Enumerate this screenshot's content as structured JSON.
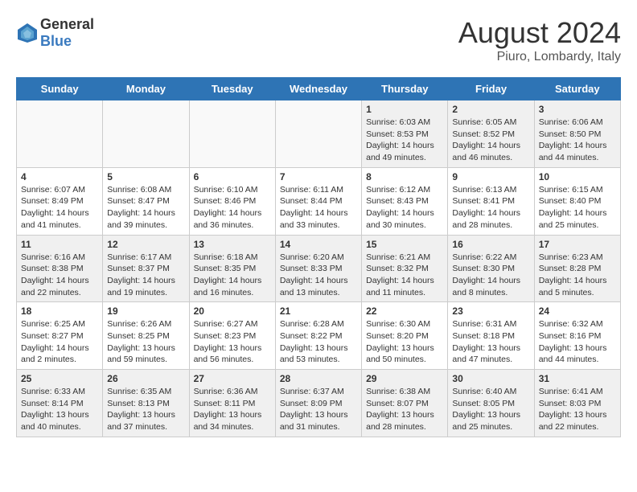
{
  "header": {
    "logo_general": "General",
    "logo_blue": "Blue",
    "month_year": "August 2024",
    "location": "Piuro, Lombardy, Italy"
  },
  "days_of_week": [
    "Sunday",
    "Monday",
    "Tuesday",
    "Wednesday",
    "Thursday",
    "Friday",
    "Saturday"
  ],
  "weeks": [
    [
      {
        "day": "",
        "content": ""
      },
      {
        "day": "",
        "content": ""
      },
      {
        "day": "",
        "content": ""
      },
      {
        "day": "",
        "content": ""
      },
      {
        "day": "1",
        "content": "Sunrise: 6:03 AM\nSunset: 8:53 PM\nDaylight: 14 hours\nand 49 minutes."
      },
      {
        "day": "2",
        "content": "Sunrise: 6:05 AM\nSunset: 8:52 PM\nDaylight: 14 hours\nand 46 minutes."
      },
      {
        "day": "3",
        "content": "Sunrise: 6:06 AM\nSunset: 8:50 PM\nDaylight: 14 hours\nand 44 minutes."
      }
    ],
    [
      {
        "day": "4",
        "content": "Sunrise: 6:07 AM\nSunset: 8:49 PM\nDaylight: 14 hours\nand 41 minutes."
      },
      {
        "day": "5",
        "content": "Sunrise: 6:08 AM\nSunset: 8:47 PM\nDaylight: 14 hours\nand 39 minutes."
      },
      {
        "day": "6",
        "content": "Sunrise: 6:10 AM\nSunset: 8:46 PM\nDaylight: 14 hours\nand 36 minutes."
      },
      {
        "day": "7",
        "content": "Sunrise: 6:11 AM\nSunset: 8:44 PM\nDaylight: 14 hours\nand 33 minutes."
      },
      {
        "day": "8",
        "content": "Sunrise: 6:12 AM\nSunset: 8:43 PM\nDaylight: 14 hours\nand 30 minutes."
      },
      {
        "day": "9",
        "content": "Sunrise: 6:13 AM\nSunset: 8:41 PM\nDaylight: 14 hours\nand 28 minutes."
      },
      {
        "day": "10",
        "content": "Sunrise: 6:15 AM\nSunset: 8:40 PM\nDaylight: 14 hours\nand 25 minutes."
      }
    ],
    [
      {
        "day": "11",
        "content": "Sunrise: 6:16 AM\nSunset: 8:38 PM\nDaylight: 14 hours\nand 22 minutes."
      },
      {
        "day": "12",
        "content": "Sunrise: 6:17 AM\nSunset: 8:37 PM\nDaylight: 14 hours\nand 19 minutes."
      },
      {
        "day": "13",
        "content": "Sunrise: 6:18 AM\nSunset: 8:35 PM\nDaylight: 14 hours\nand 16 minutes."
      },
      {
        "day": "14",
        "content": "Sunrise: 6:20 AM\nSunset: 8:33 PM\nDaylight: 14 hours\nand 13 minutes."
      },
      {
        "day": "15",
        "content": "Sunrise: 6:21 AM\nSunset: 8:32 PM\nDaylight: 14 hours\nand 11 minutes."
      },
      {
        "day": "16",
        "content": "Sunrise: 6:22 AM\nSunset: 8:30 PM\nDaylight: 14 hours\nand 8 minutes."
      },
      {
        "day": "17",
        "content": "Sunrise: 6:23 AM\nSunset: 8:28 PM\nDaylight: 14 hours\nand 5 minutes."
      }
    ],
    [
      {
        "day": "18",
        "content": "Sunrise: 6:25 AM\nSunset: 8:27 PM\nDaylight: 14 hours\nand 2 minutes."
      },
      {
        "day": "19",
        "content": "Sunrise: 6:26 AM\nSunset: 8:25 PM\nDaylight: 13 hours\nand 59 minutes."
      },
      {
        "day": "20",
        "content": "Sunrise: 6:27 AM\nSunset: 8:23 PM\nDaylight: 13 hours\nand 56 minutes."
      },
      {
        "day": "21",
        "content": "Sunrise: 6:28 AM\nSunset: 8:22 PM\nDaylight: 13 hours\nand 53 minutes."
      },
      {
        "day": "22",
        "content": "Sunrise: 6:30 AM\nSunset: 8:20 PM\nDaylight: 13 hours\nand 50 minutes."
      },
      {
        "day": "23",
        "content": "Sunrise: 6:31 AM\nSunset: 8:18 PM\nDaylight: 13 hours\nand 47 minutes."
      },
      {
        "day": "24",
        "content": "Sunrise: 6:32 AM\nSunset: 8:16 PM\nDaylight: 13 hours\nand 44 minutes."
      }
    ],
    [
      {
        "day": "25",
        "content": "Sunrise: 6:33 AM\nSunset: 8:14 PM\nDaylight: 13 hours\nand 40 minutes."
      },
      {
        "day": "26",
        "content": "Sunrise: 6:35 AM\nSunset: 8:13 PM\nDaylight: 13 hours\nand 37 minutes."
      },
      {
        "day": "27",
        "content": "Sunrise: 6:36 AM\nSunset: 8:11 PM\nDaylight: 13 hours\nand 34 minutes."
      },
      {
        "day": "28",
        "content": "Sunrise: 6:37 AM\nSunset: 8:09 PM\nDaylight: 13 hours\nand 31 minutes."
      },
      {
        "day": "29",
        "content": "Sunrise: 6:38 AM\nSunset: 8:07 PM\nDaylight: 13 hours\nand 28 minutes."
      },
      {
        "day": "30",
        "content": "Sunrise: 6:40 AM\nSunset: 8:05 PM\nDaylight: 13 hours\nand 25 minutes."
      },
      {
        "day": "31",
        "content": "Sunrise: 6:41 AM\nSunset: 8:03 PM\nDaylight: 13 hours\nand 22 minutes."
      }
    ]
  ]
}
